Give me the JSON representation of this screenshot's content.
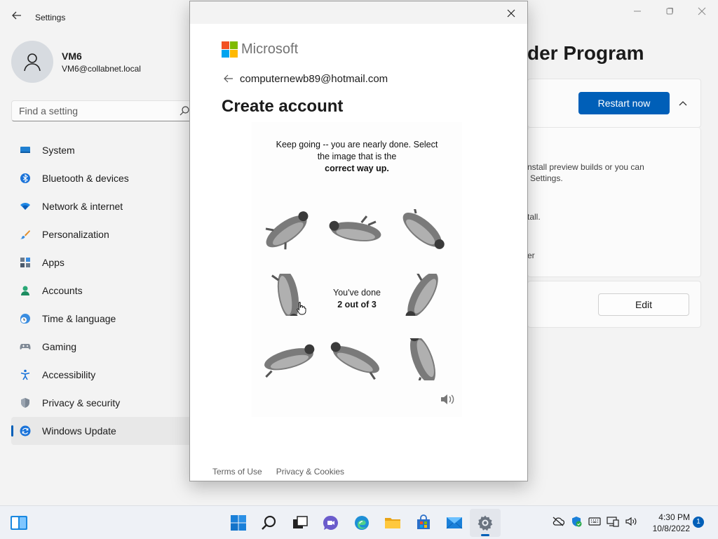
{
  "settings": {
    "title": "Settings",
    "user": {
      "name": "VM6",
      "email": "VM6@collabnet.local"
    },
    "search": {
      "placeholder": "Find a setting"
    },
    "nav": [
      {
        "label": "System",
        "icon": "monitor-icon"
      },
      {
        "label": "Bluetooth & devices",
        "icon": "bluetooth-icon"
      },
      {
        "label": "Network & internet",
        "icon": "wifi-icon"
      },
      {
        "label": "Personalization",
        "icon": "brush-icon"
      },
      {
        "label": "Apps",
        "icon": "apps-icon"
      },
      {
        "label": "Accounts",
        "icon": "person-icon"
      },
      {
        "label": "Time & language",
        "icon": "clock-globe-icon"
      },
      {
        "label": "Gaming",
        "icon": "gamepad-icon"
      },
      {
        "label": "Accessibility",
        "icon": "accessibility-icon"
      },
      {
        "label": "Privacy & security",
        "icon": "shield-icon"
      },
      {
        "label": "Windows Update",
        "icon": "update-icon",
        "active": true
      }
    ],
    "page_heading_fragment": "der Program",
    "restart_label": "Restart now",
    "edit_label": "Edit",
    "fragments": [
      "nstall preview builds or you can",
      "Settings.",
      "tall.",
      "er"
    ]
  },
  "dialog": {
    "brand": "Microsoft",
    "email": "computernewb89@hotmail.com",
    "title": "Create account",
    "captcha": {
      "instruction_line1": "Keep going -- you are nearly done. Select",
      "instruction_line2": "the image that is the",
      "instruction_bold": "correct way up.",
      "progress_line1": "You've done",
      "progress_line2": "2 out of 3"
    },
    "footer": {
      "terms": "Terms of Use",
      "privacy": "Privacy & Cookies"
    }
  },
  "taskbar": {
    "apps": [
      "start-icon",
      "search-icon",
      "task-view-icon",
      "chat-icon",
      "edge-icon",
      "file-explorer-icon",
      "store-icon",
      "mail-icon",
      "settings-gear-icon"
    ],
    "time": "4:30 PM",
    "date": "10/8/2022",
    "notification_count": "1"
  },
  "colors": {
    "accent": "#005fb8",
    "ms_red": "#f25022",
    "ms_green": "#7fba00",
    "ms_blue": "#00a4ef",
    "ms_yellow": "#ffb900"
  }
}
